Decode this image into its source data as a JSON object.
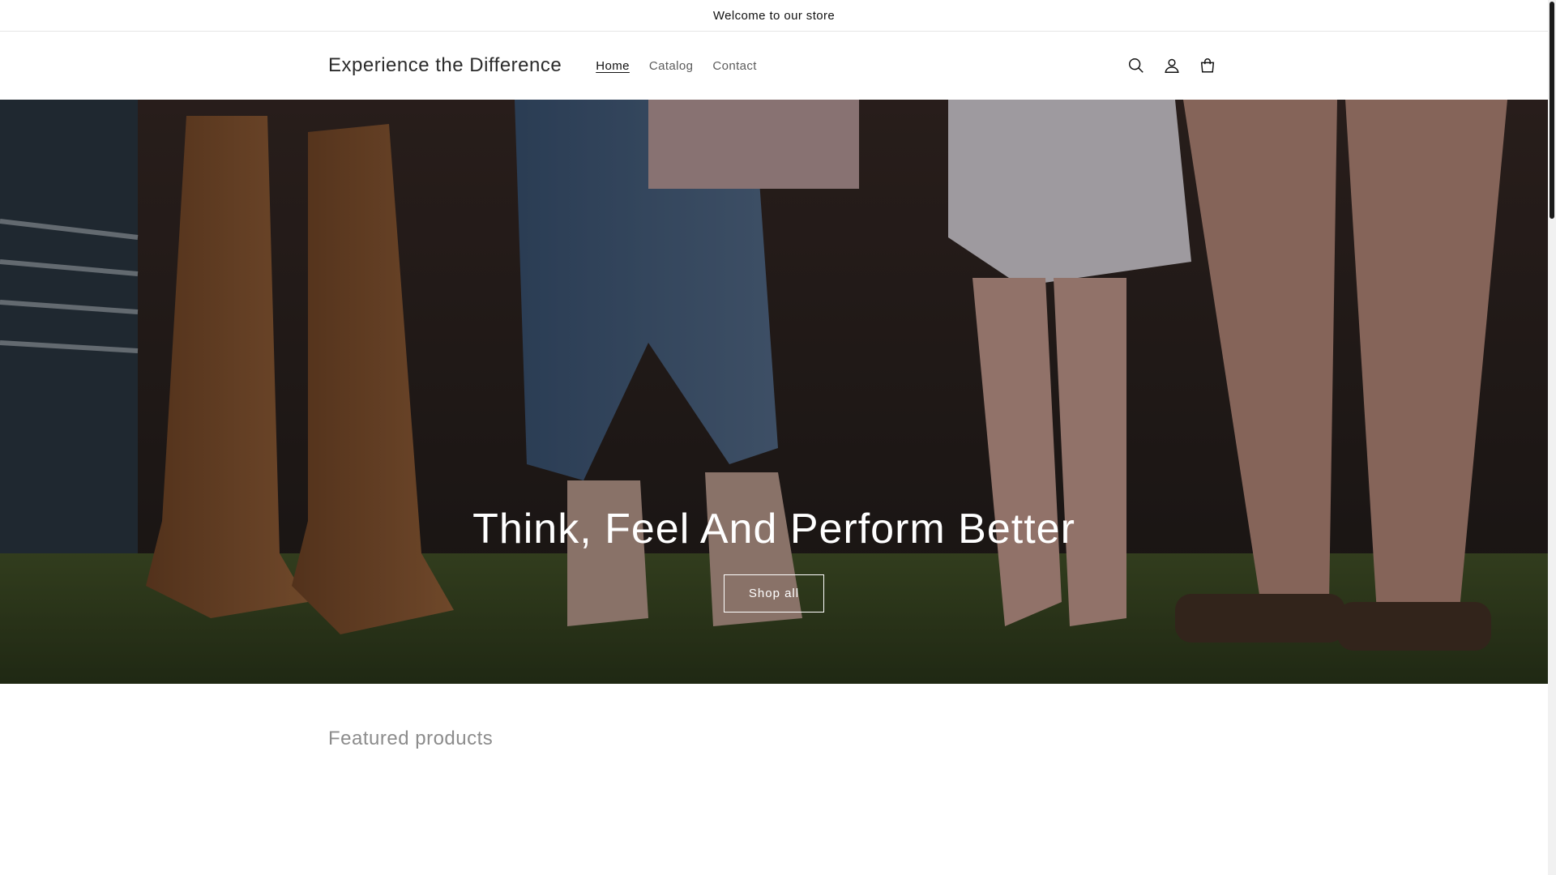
{
  "announcement": {
    "text": "Welcome to our store"
  },
  "header": {
    "brand": "Experience the Difference",
    "nav": [
      {
        "label": "Home",
        "active": true
      },
      {
        "label": "Catalog",
        "active": false
      },
      {
        "label": "Contact",
        "active": false
      }
    ],
    "icons": [
      "search-icon",
      "account-icon",
      "cart-icon"
    ]
  },
  "hero": {
    "title": "Think, Feel And Perform Better",
    "button_label": "Shop all"
  },
  "featured": {
    "title": "Featured products"
  },
  "colors": {
    "text": "#121212",
    "muted": "#5c5c5c",
    "featured_title": "#8c8c8c",
    "hero_text": "#ffffff"
  }
}
